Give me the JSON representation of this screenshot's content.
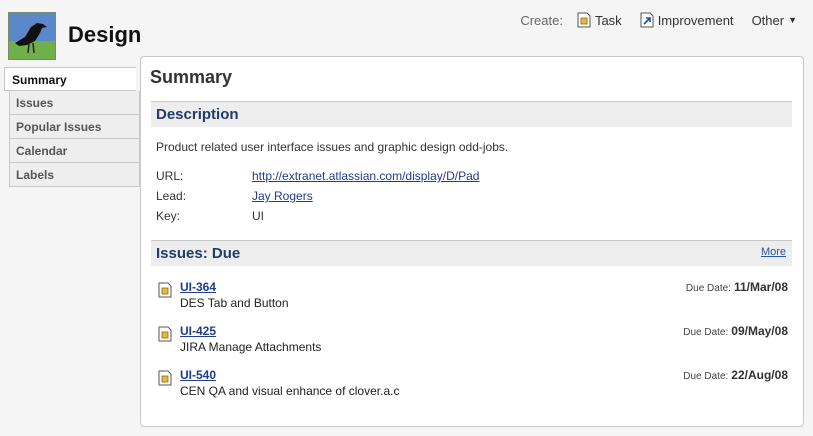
{
  "header": {
    "project_title": "Design",
    "create_label": "Create:",
    "create_items": [
      {
        "label": "Task",
        "icon": "task-icon"
      },
      {
        "label": "Improvement",
        "icon": "improvement-icon"
      },
      {
        "label": "Other",
        "icon": "chevron-down-icon"
      }
    ]
  },
  "sidebar": {
    "tabs": [
      {
        "label": "Summary",
        "active": true
      },
      {
        "label": "Issues"
      },
      {
        "label": "Popular Issues"
      },
      {
        "label": "Calendar"
      },
      {
        "label": "Labels"
      }
    ]
  },
  "main": {
    "title": "Summary",
    "description": {
      "heading": "Description",
      "text": "Product related user interface issues and graphic design odd-jobs.",
      "fields": [
        {
          "label": "URL:",
          "value": "http://extranet.atlassian.com/display/D/Pad",
          "link": true
        },
        {
          "label": "Lead:",
          "value": "Jay Rogers",
          "link": true
        },
        {
          "label": "Key:",
          "value": "UI",
          "link": false
        }
      ]
    },
    "issues_due": {
      "heading": "Issues: Due",
      "more_label": "More",
      "due_label": "Due Date:",
      "items": [
        {
          "key": "UI-364",
          "summary": "DES Tab and Button",
          "due": "11/Mar/08"
        },
        {
          "key": "UI-425",
          "summary": "JIRA Manage Attachments",
          "due": "09/May/08"
        },
        {
          "key": "UI-540",
          "summary": "CEN QA and visual enhance of clover.a.c",
          "due": "22/Aug/08"
        }
      ]
    }
  }
}
